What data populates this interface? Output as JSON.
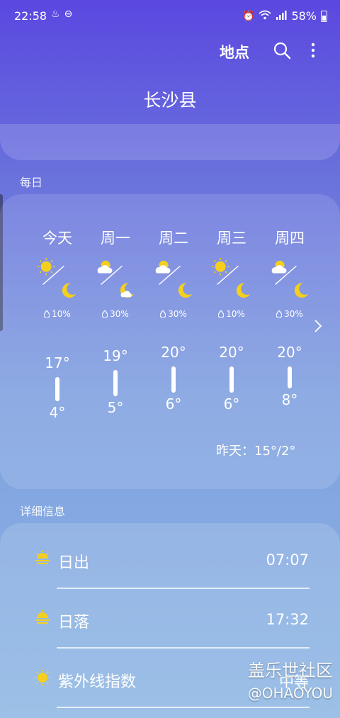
{
  "status": {
    "time": "22:58",
    "battery": "58%"
  },
  "app_bar": {
    "location_label": "地点"
  },
  "city": "长沙县",
  "daily": {
    "section_label": "每日",
    "days": [
      {
        "name": "今天",
        "day_icon": "sun-icon",
        "night_icon": "moon-icon",
        "precip": "10%",
        "high": "17°",
        "low": "4°",
        "high_value": 17,
        "low_value": 4
      },
      {
        "name": "周一",
        "day_icon": "partly-cloudy-icon",
        "night_icon": "cloudy-moon-icon",
        "precip": "30%",
        "high": "19°",
        "low": "5°",
        "high_value": 19,
        "low_value": 5
      },
      {
        "name": "周二",
        "day_icon": "partly-cloudy-icon",
        "night_icon": "moon-icon",
        "precip": "30%",
        "high": "20°",
        "low": "6°",
        "high_value": 20,
        "low_value": 6
      },
      {
        "name": "周三",
        "day_icon": "sun-icon",
        "night_icon": "moon-icon",
        "precip": "10%",
        "high": "20°",
        "low": "6°",
        "high_value": 20,
        "low_value": 6
      },
      {
        "name": "周四",
        "day_icon": "partly-cloudy-icon",
        "night_icon": "moon-icon",
        "precip": "30%",
        "high": "20°",
        "low": "8°",
        "high_value": 20,
        "low_value": 8
      }
    ],
    "yesterday": "昨天：15°/2°"
  },
  "details": {
    "section_label": "详细信息",
    "rows": [
      {
        "label": "日出",
        "value": "07:07",
        "icon": "sunrise-icon"
      },
      {
        "label": "日落",
        "value": "17:32",
        "icon": "sunset-icon"
      },
      {
        "label": "紫外线指数",
        "value": "中等",
        "icon": "uv-icon"
      }
    ]
  },
  "watermark": {
    "line1": "盖乐世社区",
    "line2": "@OHAOYOU"
  },
  "colors": {
    "sun": "#f5cf1d",
    "moon": "#f5cf1d"
  }
}
